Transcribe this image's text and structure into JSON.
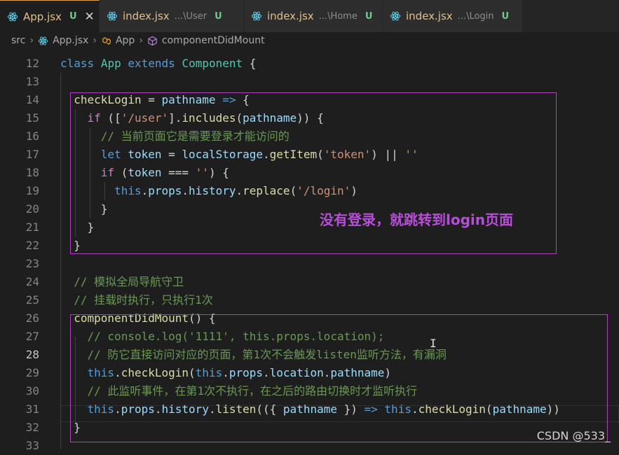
{
  "tabs": [
    {
      "name": "App.jsx",
      "path": "",
      "badge": "U",
      "active": true,
      "closable": true
    },
    {
      "name": "index.jsx",
      "path": "...\\User",
      "badge": "U",
      "active": false
    },
    {
      "name": "index.jsx",
      "path": "...\\Home",
      "badge": "U",
      "active": false
    },
    {
      "name": "index.jsx",
      "path": "...\\Login",
      "badge": "U",
      "active": false
    }
  ],
  "breadcrumb": {
    "src": "src",
    "file": "App.jsx",
    "class": "App",
    "method": "componentDidMount"
  },
  "annotation": "没有登录，就跳转到login页面",
  "watermark": "CSDN @533_",
  "colors": {
    "annotation_box": "#b53ec8",
    "annotation_text": "#b74ed8",
    "tab_active_accent": "#e0a34a",
    "untracked_badge": "#73c991"
  },
  "code": {
    "current_line": 28,
    "lines": [
      {
        "n": "12",
        "tokens": [
          [
            "kw",
            "class"
          ],
          [
            "tx",
            " "
          ],
          [
            "cls",
            "App"
          ],
          [
            "tx",
            " "
          ],
          [
            "kw",
            "extends"
          ],
          [
            "tx",
            " "
          ],
          [
            "cls",
            "Component"
          ],
          [
            "tx",
            " {"
          ]
        ]
      },
      {
        "n": "13",
        "tokens": []
      },
      {
        "n": "14",
        "tokens": [
          [
            "tx",
            "  "
          ],
          [
            "fn",
            "checkLogin"
          ],
          [
            "tx",
            " = "
          ],
          [
            "var",
            "pathname"
          ],
          [
            "tx",
            " "
          ],
          [
            "kw",
            "=>"
          ],
          [
            "tx",
            " {"
          ]
        ]
      },
      {
        "n": "15",
        "tokens": [
          [
            "tx",
            "    "
          ],
          [
            "ctl",
            "if"
          ],
          [
            "tx",
            " (["
          ],
          [
            "str",
            "'/user'"
          ],
          [
            "tx",
            "]."
          ],
          [
            "fn",
            "includes"
          ],
          [
            "tx",
            "("
          ],
          [
            "var",
            "pathname"
          ],
          [
            "tx",
            ")) {"
          ]
        ]
      },
      {
        "n": "16",
        "tokens": [
          [
            "tx",
            "      "
          ],
          [
            "cmt",
            "// 当前页面它是需要登录才能访问的"
          ]
        ]
      },
      {
        "n": "17",
        "tokens": [
          [
            "tx",
            "      "
          ],
          [
            "kw",
            "let"
          ],
          [
            "tx",
            " "
          ],
          [
            "var",
            "token"
          ],
          [
            "tx",
            " = "
          ],
          [
            "var",
            "localStorage"
          ],
          [
            "tx",
            "."
          ],
          [
            "fn",
            "getItem"
          ],
          [
            "tx",
            "("
          ],
          [
            "str",
            "'token'"
          ],
          [
            "tx",
            ") || "
          ],
          [
            "str",
            "''"
          ]
        ]
      },
      {
        "n": "18",
        "tokens": [
          [
            "tx",
            "      "
          ],
          [
            "ctl",
            "if"
          ],
          [
            "tx",
            " ("
          ],
          [
            "var",
            "token"
          ],
          [
            "tx",
            " === "
          ],
          [
            "str",
            "''"
          ],
          [
            "tx",
            ") {"
          ]
        ]
      },
      {
        "n": "19",
        "tokens": [
          [
            "tx",
            "        "
          ],
          [
            "kw",
            "this"
          ],
          [
            "tx",
            "."
          ],
          [
            "prop",
            "props"
          ],
          [
            "tx",
            "."
          ],
          [
            "prop",
            "history"
          ],
          [
            "tx",
            "."
          ],
          [
            "fn",
            "replace"
          ],
          [
            "tx",
            "("
          ],
          [
            "str",
            "'/login'"
          ],
          [
            "tx",
            ")"
          ]
        ]
      },
      {
        "n": "20",
        "tokens": [
          [
            "tx",
            "      }"
          ]
        ]
      },
      {
        "n": "21",
        "tokens": [
          [
            "tx",
            "    }"
          ]
        ]
      },
      {
        "n": "22",
        "tokens": [
          [
            "tx",
            "  }"
          ]
        ]
      },
      {
        "n": "23",
        "tokens": []
      },
      {
        "n": "24",
        "tokens": [
          [
            "tx",
            "  "
          ],
          [
            "cmt",
            "// 模拟全局导航守卫"
          ]
        ]
      },
      {
        "n": "25",
        "tokens": [
          [
            "tx",
            "  "
          ],
          [
            "cmt",
            "// 挂载时执行，只执行1次"
          ]
        ]
      },
      {
        "n": "26",
        "tokens": [
          [
            "tx",
            "  "
          ],
          [
            "fn",
            "componentDidMount"
          ],
          [
            "tx",
            "() {"
          ]
        ]
      },
      {
        "n": "27",
        "tokens": [
          [
            "tx",
            "    "
          ],
          [
            "cmt",
            "// console.log('1111', this.props.location);"
          ]
        ]
      },
      {
        "n": "28",
        "tokens": [
          [
            "tx",
            "    "
          ],
          [
            "cmt",
            "// 防它直接访问对应的页面，第1次不会触发listen监听方法，有漏洞"
          ]
        ]
      },
      {
        "n": "29",
        "tokens": [
          [
            "tx",
            "    "
          ],
          [
            "kw",
            "this"
          ],
          [
            "tx",
            "."
          ],
          [
            "fn",
            "checkLogin"
          ],
          [
            "tx",
            "("
          ],
          [
            "kw",
            "this"
          ],
          [
            "tx",
            "."
          ],
          [
            "prop",
            "props"
          ],
          [
            "tx",
            "."
          ],
          [
            "prop",
            "location"
          ],
          [
            "tx",
            "."
          ],
          [
            "prop",
            "pathname"
          ],
          [
            "tx",
            ")"
          ]
        ]
      },
      {
        "n": "30",
        "tokens": [
          [
            "tx",
            "    "
          ],
          [
            "cmt",
            "// 此监听事件，在第1次不执行，在之后的路由切换时才监听执行"
          ]
        ]
      },
      {
        "n": "31",
        "tokens": [
          [
            "tx",
            "    "
          ],
          [
            "kw",
            "this"
          ],
          [
            "tx",
            "."
          ],
          [
            "prop",
            "props"
          ],
          [
            "tx",
            "."
          ],
          [
            "prop",
            "history"
          ],
          [
            "tx",
            "."
          ],
          [
            "fn",
            "listen"
          ],
          [
            "tx",
            "(({ "
          ],
          [
            "var",
            "pathname"
          ],
          [
            "tx",
            " }) "
          ],
          [
            "kw",
            "=>"
          ],
          [
            "tx",
            " "
          ],
          [
            "kw",
            "this"
          ],
          [
            "tx",
            "."
          ],
          [
            "fn",
            "checkLogin"
          ],
          [
            "tx",
            "("
          ],
          [
            "var",
            "pathname"
          ],
          [
            "tx",
            "))"
          ]
        ]
      },
      {
        "n": "32",
        "tokens": [
          [
            "tx",
            "  }"
          ]
        ]
      },
      {
        "n": "33",
        "tokens": []
      }
    ]
  }
}
